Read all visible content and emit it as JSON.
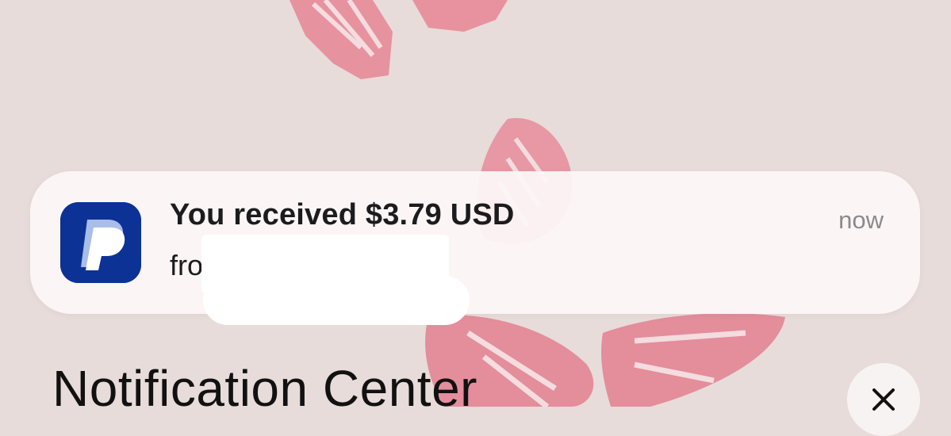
{
  "notification": {
    "app_icon": "paypal-icon",
    "title": "You received $3.79 USD",
    "body_visible": "from",
    "time": "now"
  },
  "notification_center": {
    "title": "Notification Center",
    "close_icon": "close-icon"
  },
  "colors": {
    "paypal_blue": "#0d3296",
    "butterfly_pink": "#e88a99",
    "wallpaper": "#e7dcd9"
  }
}
